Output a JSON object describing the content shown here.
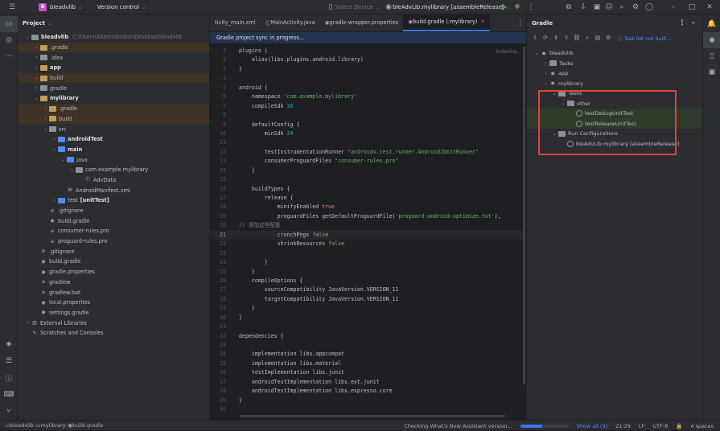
{
  "titlebar": {
    "project_badge": "B",
    "project_name": "bleadvlib",
    "vcs_label": "Version control",
    "device_label": "Select Device",
    "run_config": "bleAdvLib:mylibrary [assembleRelease]"
  },
  "colors": {
    "accent": "#3574f0",
    "run": "#57965c",
    "highlight_box": "#e0443e",
    "badge": "#c74ec2"
  },
  "project_panel": {
    "title": "Project",
    "tree": [
      {
        "indent": 0,
        "arrow": "v",
        "icon": "folder-grey",
        "label": "bleadvlib",
        "hint": "C:\\Users\\Administrator\\Desktop\\bleadvlib",
        "bold": true
      },
      {
        "indent": 1,
        "arrow": ">",
        "icon": "folder-orange",
        "label": ".gradle",
        "excluded": true
      },
      {
        "indent": 1,
        "arrow": ">",
        "icon": "folder-grey",
        "label": ".idea"
      },
      {
        "indent": 1,
        "arrow": ">",
        "icon": "folder-orange",
        "label": "app",
        "bold": true
      },
      {
        "indent": 1,
        "arrow": ">",
        "icon": "folder-orange",
        "label": "build",
        "excluded": true
      },
      {
        "indent": 1,
        "arrow": ">",
        "icon": "folder-grey",
        "label": "gradle"
      },
      {
        "indent": 1,
        "arrow": "v",
        "icon": "folder-orange",
        "label": "mylibrary",
        "bold": true
      },
      {
        "indent": 2,
        "arrow": ">",
        "icon": "folder-orange",
        "label": ".gradle",
        "excluded": true
      },
      {
        "indent": 2,
        "arrow": ">",
        "icon": "folder-orange",
        "label": "build",
        "excluded": true
      },
      {
        "indent": 2,
        "arrow": "v",
        "icon": "folder-grey",
        "label": "src"
      },
      {
        "indent": 3,
        "arrow": ">",
        "icon": "folder-blue",
        "label": "androidTest",
        "bold": true
      },
      {
        "indent": 3,
        "arrow": "v",
        "icon": "folder-blue",
        "label": "main",
        "bold": true
      },
      {
        "indent": 4,
        "arrow": "v",
        "icon": "folder-blue",
        "label": "java"
      },
      {
        "indent": 5,
        "arrow": "v",
        "icon": "folder-grey",
        "label": "com.example.mylibrary"
      },
      {
        "indent": 6,
        "arrow": "",
        "icon": "file-class",
        "label": "AdvData"
      },
      {
        "indent": 4,
        "arrow": "",
        "icon": "file-xml",
        "label": "AndroidManifest.xml"
      },
      {
        "indent": 3,
        "arrow": ">",
        "icon": "folder-blue",
        "label": "test",
        "tag": "[unitTest]"
      },
      {
        "indent": 2,
        "arrow": "",
        "icon": "file-ignore",
        "label": ".gitignore"
      },
      {
        "indent": 2,
        "arrow": "",
        "icon": "file-gradle",
        "label": "build.gradle"
      },
      {
        "indent": 2,
        "arrow": "",
        "icon": "file-text",
        "label": "consumer-rules.pro"
      },
      {
        "indent": 2,
        "arrow": "",
        "icon": "file-text",
        "label": "proguard-rules.pro"
      },
      {
        "indent": 1,
        "arrow": "",
        "icon": "file-ignore",
        "label": ".gitignore"
      },
      {
        "indent": 1,
        "arrow": "",
        "icon": "file-gradle",
        "label": "build.gradle"
      },
      {
        "indent": 1,
        "arrow": "",
        "icon": "file-gradle",
        "label": "gradle.properties"
      },
      {
        "indent": 1,
        "arrow": "",
        "icon": "file-text",
        "label": "gradlew"
      },
      {
        "indent": 1,
        "arrow": "",
        "icon": "file-text",
        "label": "gradlew.bat"
      },
      {
        "indent": 1,
        "arrow": "",
        "icon": "file-gradle",
        "label": "local.properties"
      },
      {
        "indent": 1,
        "arrow": "",
        "icon": "file-gradle",
        "label": "settings.gradle"
      },
      {
        "indent": 0,
        "arrow": ">",
        "icon": "libraries",
        "label": "External Libraries"
      },
      {
        "indent": 0,
        "arrow": "",
        "icon": "scratches",
        "label": "Scratches and Consoles"
      }
    ]
  },
  "editor": {
    "tabs": [
      {
        "label": "tivity_main.xml",
        "active": false
      },
      {
        "label": "MainActivity.java",
        "active": false
      },
      {
        "label": "gradle-wrapper.properties",
        "active": false
      },
      {
        "label": "build.gradle (:mylibrary)",
        "active": true
      }
    ],
    "banner": "Gradle project sync in progress...",
    "indexing": "Indexing...",
    "current_line": 21,
    "lines": [
      [
        [
          "p",
          "plugins {"
        ]
      ],
      [
        [
          "p",
          "    alias(libs.plugins.android.library)"
        ]
      ],
      [
        [
          "p",
          "}"
        ]
      ],
      [
        [
          "p",
          ""
        ]
      ],
      [
        [
          "p",
          "android {"
        ]
      ],
      [
        [
          "p",
          "    namespace "
        ],
        [
          "s",
          "'com.example.mylibrary'"
        ]
      ],
      [
        [
          "p",
          "    compileSdk "
        ],
        [
          "n",
          "36"
        ]
      ],
      [
        [
          "p",
          ""
        ]
      ],
      [
        [
          "p",
          "    defaultConfig {"
        ]
      ],
      [
        [
          "p",
          "        minSdk "
        ],
        [
          "n",
          "24"
        ]
      ],
      [
        [
          "p",
          ""
        ]
      ],
      [
        [
          "p",
          "        testInstrumentationRunner "
        ],
        [
          "s",
          "\"androidx.test.runner.AndroidJUnitRunner\""
        ]
      ],
      [
        [
          "p",
          "        consumerProguardFiles "
        ],
        [
          "s",
          "\"consumer-rules.pro\""
        ]
      ],
      [
        [
          "p",
          "    }"
        ]
      ],
      [
        [
          "p",
          ""
        ]
      ],
      [
        [
          "p",
          "    buildTypes {"
        ]
      ],
      [
        [
          "p",
          "        release {"
        ]
      ],
      [
        [
          "p",
          "            minifyEnabled "
        ],
        [
          "k",
          "true"
        ]
      ],
      [
        [
          "p",
          "            proguardFiles getDefaultProguardFile("
        ],
        [
          "s",
          "'proguard-android-optimize.txt'"
        ],
        [
          "p",
          "), "
        ]
      ],
      [
        [
          "c",
          "// 添加这些配置"
        ]
      ],
      [
        [
          "p",
          "            crunchPngs "
        ],
        [
          "k",
          "false"
        ]
      ],
      [
        [
          "p",
          "            shrinkResources "
        ],
        [
          "k",
          "false"
        ]
      ],
      [
        [
          "p",
          ""
        ]
      ],
      [
        [
          "p",
          "        }"
        ]
      ],
      [
        [
          "p",
          "    }"
        ]
      ],
      [
        [
          "p",
          "    compileOptions {"
        ]
      ],
      [
        [
          "p",
          "        sourceCompatibility JavaVersion.VERSION_11"
        ]
      ],
      [
        [
          "p",
          "        targetCompatibility JavaVersion.VERSION_11"
        ]
      ],
      [
        [
          "p",
          "    }"
        ]
      ],
      [
        [
          "p",
          "}"
        ]
      ],
      [
        [
          "p",
          ""
        ]
      ],
      [
        [
          "p",
          "dependencies {"
        ]
      ],
      [
        [
          "p",
          ""
        ]
      ],
      [
        [
          "p",
          "    implementation libs.appcompat"
        ]
      ],
      [
        [
          "p",
          "    implementation libs.material"
        ]
      ],
      [
        [
          "p",
          "    testImplementation libs.junit"
        ]
      ],
      [
        [
          "p",
          "    androidTestImplementation libs.ext.junit"
        ]
      ],
      [
        [
          "p",
          "    androidTestImplementation libs.espresso.core"
        ]
      ],
      [
        [
          "p",
          "}"
        ]
      ],
      [
        [
          "p",
          ""
        ]
      ]
    ]
  },
  "gradle_panel": {
    "title": "Gradle",
    "status": "Task list not built...",
    "tree": [
      {
        "indent": 0,
        "arrow": "v",
        "icon": "gradle",
        "label": "bleadvlib"
      },
      {
        "indent": 1,
        "arrow": ">",
        "icon": "folder",
        "label": "Tasks"
      },
      {
        "indent": 1,
        "arrow": ">",
        "icon": "gradle",
        "label": "app"
      },
      {
        "indent": 1,
        "arrow": "v",
        "icon": "gradle",
        "label": "mylibrary"
      },
      {
        "indent": 2,
        "arrow": "v",
        "icon": "folder",
        "label": "Tasks"
      },
      {
        "indent": 3,
        "arrow": "v",
        "icon": "folder",
        "label": "other"
      },
      {
        "indent": 4,
        "arrow": "",
        "icon": "gear",
        "label": "testDebugUnitTest",
        "hl": true
      },
      {
        "indent": 4,
        "arrow": "",
        "icon": "gear",
        "label": "testReleaseUnitTest",
        "hl": true
      },
      {
        "indent": 2,
        "arrow": "v",
        "icon": "folder",
        "label": "Run Configurations"
      },
      {
        "indent": 3,
        "arrow": "",
        "icon": "gear",
        "label": "bleAdvLib:mylibrary [assembleRelease]"
      }
    ]
  },
  "statusbar": {
    "breadcrumb": [
      "bleadvlib",
      "mylibrary",
      "build.gradle"
    ],
    "task": "Checking What's New Assistant version...",
    "progress": 0.45,
    "show_all": "Show all (3)",
    "position": "21:29",
    "line_sep": "LF",
    "encoding": "UTF-8",
    "indent": "4 spaces"
  }
}
